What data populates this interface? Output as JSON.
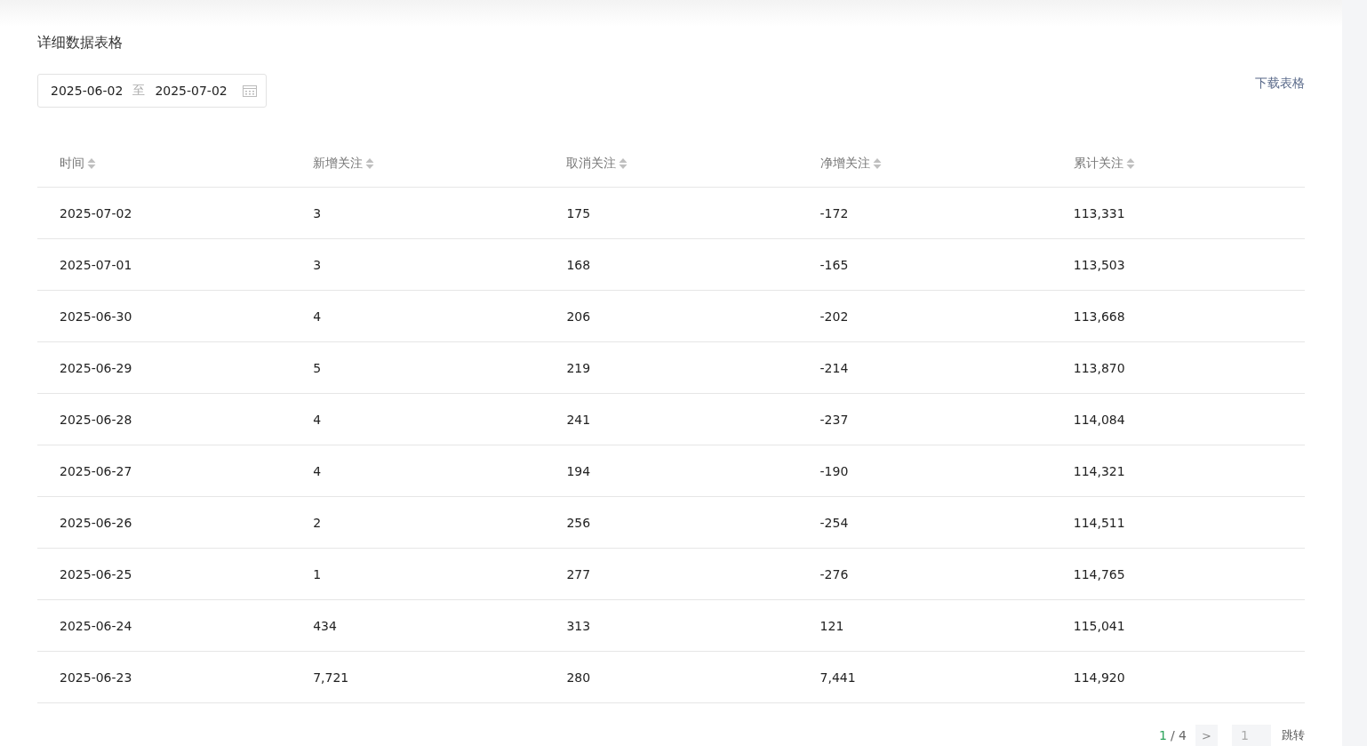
{
  "title": "详细数据表格",
  "date_range": {
    "start": "2025-06-02",
    "separator": "至",
    "end": "2025-07-02"
  },
  "download_link": "下载表格",
  "table": {
    "columns": [
      "时间",
      "新增关注",
      "取消关注",
      "净增关注",
      "累计关注"
    ],
    "rows": [
      [
        "2025-07-02",
        "3",
        "175",
        "-172",
        "113,331"
      ],
      [
        "2025-07-01",
        "3",
        "168",
        "-165",
        "113,503"
      ],
      [
        "2025-06-30",
        "4",
        "206",
        "-202",
        "113,668"
      ],
      [
        "2025-06-29",
        "5",
        "219",
        "-214",
        "113,870"
      ],
      [
        "2025-06-28",
        "4",
        "241",
        "-237",
        "114,084"
      ],
      [
        "2025-06-27",
        "4",
        "194",
        "-190",
        "114,321"
      ],
      [
        "2025-06-26",
        "2",
        "256",
        "-254",
        "114,511"
      ],
      [
        "2025-06-25",
        "1",
        "277",
        "-276",
        "114,765"
      ],
      [
        "2025-06-24",
        "434",
        "313",
        "121",
        "115,041"
      ],
      [
        "2025-06-23",
        "7,721",
        "280",
        "7,441",
        "114,920"
      ]
    ]
  },
  "pagination": {
    "current": "1",
    "total": "/ 4",
    "next": ">",
    "jump_placeholder": "1",
    "jump_button": "跳转"
  }
}
